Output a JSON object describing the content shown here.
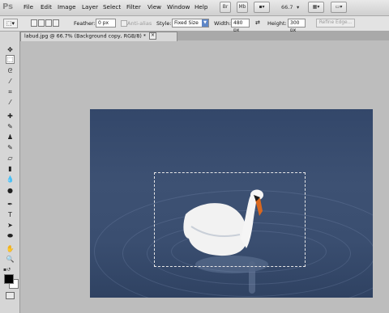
{
  "app": {
    "logo": "Ps"
  },
  "menu": [
    "File",
    "Edit",
    "Image",
    "Layer",
    "Select",
    "Filter",
    "View",
    "Window",
    "Help"
  ],
  "menubar_right": {
    "br": "Br",
    "mb": "Mb",
    "zoom": "66.7"
  },
  "options": {
    "feather_label": "Feather:",
    "feather_value": "0 px",
    "antialias_label": "Anti-alias",
    "style_label": "Style:",
    "style_value": "Fixed Size",
    "width_label": "Width:",
    "width_value": "480 px",
    "height_label": "Height:",
    "height_value": "300 px",
    "refine_edge": "Refine Edge..."
  },
  "document_tab": {
    "title": "labud.jpg @ 66.7% (Background copy, RGB/8) *",
    "close": "×"
  },
  "tools": [
    "move-tool",
    "rectangular-marquee-tool",
    "lasso-tool",
    "quick-selection-tool",
    "crop-tool",
    "eyedropper-tool",
    "spot-healing-brush-tool",
    "brush-tool",
    "clone-stamp-tool",
    "history-brush-tool",
    "eraser-tool",
    "gradient-tool",
    "blur-tool",
    "dodge-tool",
    "pen-tool",
    "type-tool",
    "path-selection-tool",
    "shape-tool",
    "hand-tool",
    "zoom-tool"
  ],
  "colors": {
    "foreground": "#000000",
    "background": "#ffffff",
    "workspace": "#bdbdbd",
    "water": "#3a4e70"
  }
}
